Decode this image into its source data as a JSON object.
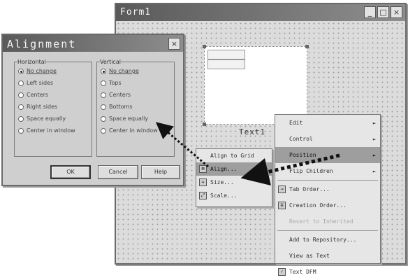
{
  "form_window": {
    "title": "Form1",
    "label_text": "Text1",
    "title_buttons": [
      "_",
      "□",
      "×"
    ]
  },
  "alignment_dialog": {
    "title": "Alignment",
    "close_glyph": "×",
    "horizontal": {
      "legend": "Horizontal",
      "options": [
        {
          "label": "No change",
          "selected": true
        },
        {
          "label": "Left sides",
          "selected": false
        },
        {
          "label": "Centers",
          "selected": false
        },
        {
          "label": "Right sides",
          "selected": false
        },
        {
          "label": "Space equally",
          "selected": false
        },
        {
          "label": "Center in window",
          "selected": false
        }
      ]
    },
    "vertical": {
      "legend": "Vertical",
      "options": [
        {
          "label": "No change",
          "selected": true
        },
        {
          "label": "Tops",
          "selected": false
        },
        {
          "label": "Centers",
          "selected": false
        },
        {
          "label": "Bottoms",
          "selected": false
        },
        {
          "label": "Space equally",
          "selected": false
        },
        {
          "label": "Center in window",
          "selected": false
        }
      ]
    },
    "buttons": {
      "ok": "OK",
      "cancel": "Cancel",
      "help": "Help"
    }
  },
  "submenu": {
    "items": [
      {
        "label": "Align to Grid",
        "icon": "",
        "selected": false
      },
      {
        "label": "Align...",
        "icon": "align-icon",
        "selected": true
      },
      {
        "label": "Size...",
        "icon": "size-icon",
        "selected": false
      },
      {
        "label": "Scale...",
        "icon": "scale-icon",
        "selected": false
      }
    ]
  },
  "context_menu": {
    "items": [
      {
        "label": "Edit",
        "arrow": "►",
        "state": "normal",
        "icon": ""
      },
      {
        "label": "Control",
        "arrow": "►",
        "state": "normal",
        "icon": ""
      },
      {
        "label": "Position",
        "arrow": "►",
        "state": "selected",
        "icon": ""
      },
      {
        "label": "Flip Children",
        "arrow": "►",
        "state": "normal",
        "icon": ""
      },
      {
        "label": "Tab Order...",
        "arrow": "",
        "state": "normal",
        "icon": "tab-order-icon"
      },
      {
        "label": "Creation Order...",
        "arrow": "",
        "state": "normal",
        "icon": "creation-order-icon"
      },
      {
        "label": "Revert to Inherited",
        "arrow": "",
        "state": "disabled",
        "icon": ""
      },
      {
        "label": "Add to Repository...",
        "arrow": "",
        "state": "normal",
        "icon": ""
      },
      {
        "label": "View as Text",
        "arrow": "",
        "state": "normal",
        "icon": ""
      },
      {
        "label": "Text DFM",
        "arrow": "",
        "state": "normal",
        "icon": "check-icon"
      }
    ]
  },
  "colors": {
    "arrow": "#111111",
    "selection": "#9e9e9e"
  }
}
